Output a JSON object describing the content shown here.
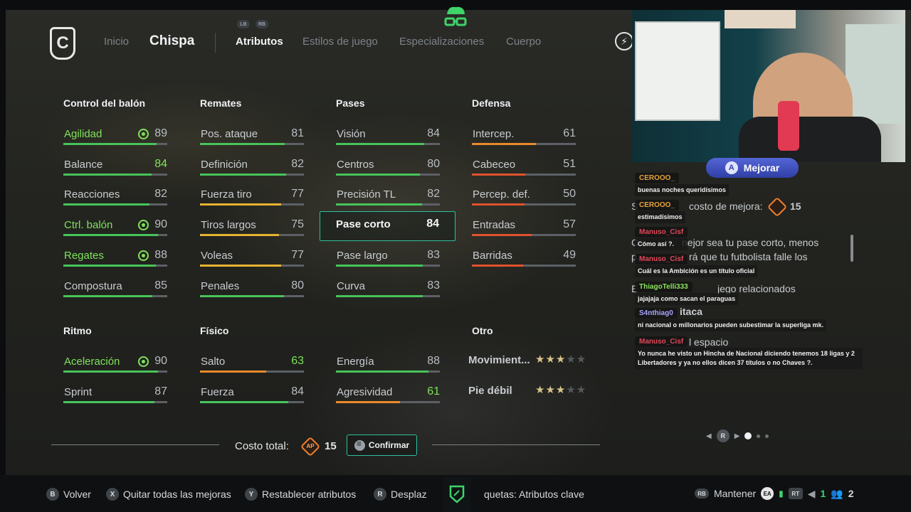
{
  "header": {
    "logo_letter": "C",
    "nav": [
      {
        "label": "Inicio",
        "active": false
      },
      {
        "label": "Chispa",
        "active": true
      },
      {
        "label": "Atributos",
        "active": true
      },
      {
        "label": "Estilos de juego",
        "active": false
      },
      {
        "label": "Especializaciones",
        "active": false
      },
      {
        "label": "Cuerpo",
        "active": false
      }
    ],
    "bumper_left": "LB",
    "bumper_right": "RB"
  },
  "groups": {
    "control": {
      "title": "Control del balón",
      "stats": [
        {
          "name": "Agilidad",
          "value": "89",
          "highlight": true,
          "target": true
        },
        {
          "name": "Balance",
          "value": "84",
          "value_green": true
        },
        {
          "name": "Reacciones",
          "value": "82"
        },
        {
          "name": "Ctrl. balón",
          "value": "90",
          "highlight": true,
          "target": true
        },
        {
          "name": "Regates",
          "value": "88",
          "highlight": true,
          "target": true
        },
        {
          "name": "Compostura",
          "value": "85"
        }
      ]
    },
    "remates": {
      "title": "Remates",
      "stats": [
        {
          "name": "Pos. ataque",
          "value": "81"
        },
        {
          "name": "Definición",
          "value": "82"
        },
        {
          "name": "Fuerza tiro",
          "value": "77"
        },
        {
          "name": "Tiros largos",
          "value": "75"
        },
        {
          "name": "Voleas",
          "value": "77"
        },
        {
          "name": "Penales",
          "value": "80"
        }
      ]
    },
    "pases": {
      "title": "Pases",
      "stats": [
        {
          "name": "Visión",
          "value": "84"
        },
        {
          "name": "Centros",
          "value": "80"
        },
        {
          "name": "Precisión TL",
          "value": "82"
        },
        {
          "name": "Pase corto",
          "value": "84",
          "selected": true
        },
        {
          "name": "Pase largo",
          "value": "83"
        },
        {
          "name": "Curva",
          "value": "83"
        }
      ]
    },
    "defensa": {
      "title": "Defensa",
      "stats": [
        {
          "name": "Intercep.",
          "value": "61"
        },
        {
          "name": "Cabeceo",
          "value": "51"
        },
        {
          "name": "Percep. def.",
          "value": "50"
        },
        {
          "name": "Entradas",
          "value": "57"
        },
        {
          "name": "Barridas",
          "value": "49"
        }
      ]
    },
    "ritmo": {
      "title": "Ritmo",
      "stats": [
        {
          "name": "Aceleración",
          "value": "90",
          "highlight": true,
          "target": true
        },
        {
          "name": "Sprint",
          "value": "87"
        }
      ]
    },
    "fisico": {
      "title": "Físico",
      "stats": [
        {
          "name": "Salto",
          "value": "63",
          "value_green": true
        },
        {
          "name": "Fuerza",
          "value": "84"
        },
        {
          "name": "Energía",
          "value": "88"
        },
        {
          "name": "Agresividad",
          "value": "61",
          "value_green": true
        }
      ]
    },
    "otro": {
      "title": "Otro",
      "stars": [
        {
          "name": "Movimient...",
          "rating": 3,
          "max": 5
        },
        {
          "name": "Pie débil",
          "rating": 3,
          "max": 5
        }
      ]
    }
  },
  "footer": {
    "cost_label": "Costo total:",
    "ap_label": "AP",
    "cost_value": "15",
    "confirm_label": "Confirmar"
  },
  "bottom_bar": {
    "left": [
      {
        "key": "B",
        "label": "Volver"
      },
      {
        "key": "X",
        "label": "Quitar todas las mejoras"
      },
      {
        "key": "Y",
        "label": "Restablecer atributos"
      },
      {
        "key": "R",
        "label": "Desplaz"
      }
    ],
    "etiquetas": "quetas: Atributos clave",
    "rb": "RB",
    "mantener": "Mantener",
    "ea": "EA",
    "rt": "RT",
    "count1": "1",
    "count2": "2"
  },
  "side_panel": {
    "mejorar_key": "A",
    "mejorar_label": "Mejorar",
    "underlying": [
      {
        "text": "S"
      },
      {
        "text": "costo de mejora:"
      },
      {
        "text": "15"
      },
      {
        "text": "C"
      },
      {
        "text": "nejor sea tu pase corto, menos"
      },
      {
        "text": "p"
      },
      {
        "text": "rá que tu futbolista falle los"
      },
      {
        "text": "E"
      },
      {
        "text": "jego relacionados"
      },
      {
        "text": "itaca"
      },
      {
        "text": "l espacio"
      }
    ],
    "chat": [
      {
        "user": "CEROOO_",
        "user_color": "#e7a33c",
        "text": "buenas noches queridísimos"
      },
      {
        "user": "CEROOO_",
        "user_color": "#e7a33c",
        "text": "estimadísimos"
      },
      {
        "user": "Manuso_Cisf",
        "user_color": "#e0475a",
        "text": "Cómo así ?."
      },
      {
        "user": "Manuso_Cisf",
        "user_color": "#e0475a",
        "text": "Cuál es la Ambición es un título oficial"
      },
      {
        "user": "ThiagoTelli333",
        "user_color": "#8be35f",
        "text": "jajajaja como sacan el paraguas"
      },
      {
        "user": "S4nthiag0",
        "user_color": "#a9a4ff",
        "text": "ni nacional o millonarios pueden subestimar la superliga mk."
      },
      {
        "user": "Manuso_Cisf",
        "user_color": "#e0475a",
        "text": "Yo nunca he visto un Hincha de Nacional diciendo tenemos 18 ligas y 2 Libertadores y ya no ellos dicen 37 títulos o no Chaves ?."
      }
    ],
    "pager_key": "R"
  }
}
